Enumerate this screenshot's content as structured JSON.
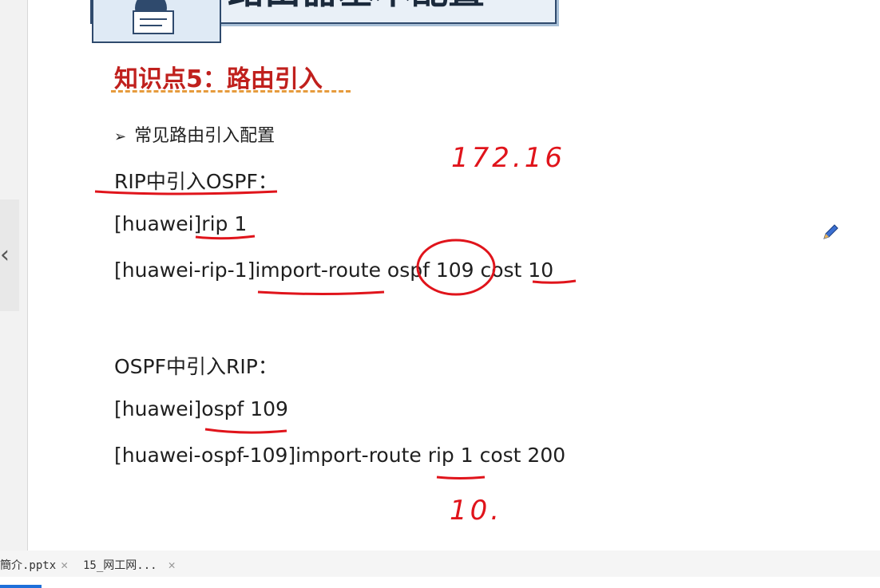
{
  "slide": {
    "title": "路由器基本配置",
    "topic": "知识点5：路由引入",
    "bullet": "常见路由引入配置",
    "rip_heading": "RIP中引入OSPF：",
    "rip_cmd1": "[huawei]rip 1",
    "rip_cmd2": "[huawei-rip-1]import-route ospf 109 cost 10",
    "ospf_heading": "OSPF中引入RIP：",
    "ospf_cmd1": "[huawei]ospf 109",
    "ospf_cmd2": "[huawei-ospf-109]import-route rip 1 cost 200"
  },
  "annotations": {
    "note_top": "172.16",
    "note_bottom": "10.",
    "ink_color": "#e0141b"
  },
  "tabs": [
    {
      "label": "簡介.pptx"
    },
    {
      "label": "15_网工网..."
    }
  ],
  "icons": {
    "left_nav": "chevron-left-icon",
    "pen": "pencil-icon",
    "close": "close-icon"
  },
  "colors": {
    "topic": "#c0201d",
    "underline_dash": "#e69b3d",
    "accent_bar": "#1e6fd9"
  }
}
